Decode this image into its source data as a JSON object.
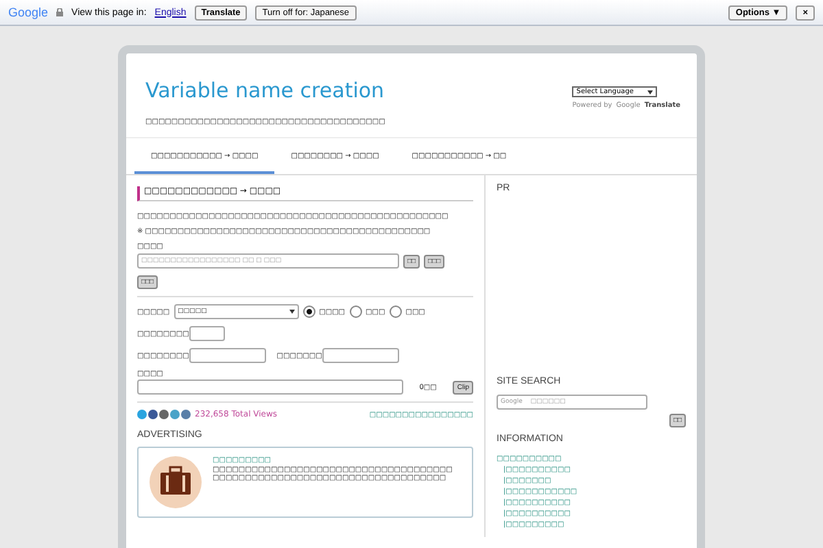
{
  "translate_bar": {
    "logo": "Google",
    "label": "View this page in:",
    "language": "English",
    "buttons": [
      "Translate",
      "Turn off for: Japanese"
    ],
    "options": "Options ▼",
    "close": "×"
  },
  "header": {
    "title": "Variable name creation",
    "subtitle": "□□□□□□□□□□□□□□□□□□□□□□□□□□□□□□□□□□□□□",
    "language_select": "Select Language",
    "powered_by": "Powered by",
    "brand": "Google",
    "translate": "Translate"
  },
  "tabs": [
    {
      "label": "□□□□□□□□□□□ → □□□□",
      "selected": true
    },
    {
      "label": "□□□□□□□□ → □□□□",
      "selected": false
    },
    {
      "label": "□□□□□□□□□□□ → □□",
      "selected": false
    }
  ],
  "main": {
    "heading": "□□□□□□□□□□□□ → □□□□",
    "intro": "□□□□□□□□□□□□□□□□□□□□□□□□□□□□□□□□□□□□□□□□□□□□□□□□",
    "note": "※ □□□□□□□□□□□□□□□□□□□□□□□□□□□□□□□□□□□□□□□□□□□□",
    "input_label": "□□□□",
    "input_placeholder": "□□□□□□□□□□□□□□□□□ □□ □ □□□",
    "input_buttons": [
      "□□",
      "□□□"
    ],
    "extra_button": "□□□",
    "select_label": "□□□□□",
    "select_value": "□□□□□",
    "radios": [
      {
        "label": "□□□□",
        "selected": true
      },
      {
        "label": "□□□",
        "selected": false
      },
      {
        "label": "□□□",
        "selected": false
      }
    ],
    "field_a_label": "□□□□□□□□",
    "field_b_label": "□□□□□□□□",
    "field_c_label": "□□□□□□□",
    "output_label": "□□□□",
    "count": "0□□",
    "clip": "Clip",
    "views": "232,658 Total Views",
    "link": "□□□□□□□□□□□□□□□□"
  },
  "advertising": {
    "heading": "ADVERTISING",
    "title": "□□□□□□□□□",
    "description": "□□□□□□□□□□□□□□□□□□□□□□□□□□□□□□□□□□□□□□□□□□□□□□□□□□□□□□□□□□□□□□□□□□□□□□□□□"
  },
  "sidebar": {
    "pr": "PR",
    "search_heading": "SITE SEARCH",
    "search_brand": "Google",
    "search_placeholder": "□□□□□□",
    "search_button": "□□",
    "info_heading": "INFORMATION",
    "info_links": [
      {
        "label": "□□□□□□□□□□",
        "children": [
          {
            "label": "|□□□□□□□□□□"
          },
          {
            "label": "|□□□□□□□"
          },
          {
            "label": "|□□□□□□□□□□□"
          },
          {
            "label": "|□□□□□□□□□□"
          },
          {
            "label": "|□□□□□□□□□□"
          },
          {
            "label": "|□□□□□□□□□"
          }
        ]
      }
    ]
  }
}
